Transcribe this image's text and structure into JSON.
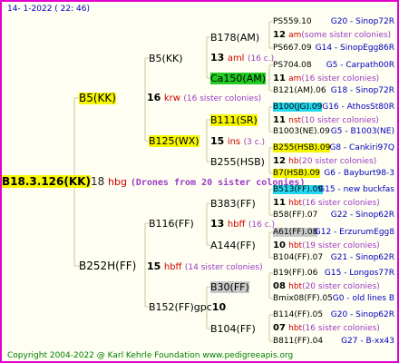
{
  "stamp": "14-  1-2022 (  22:  46)",
  "root": {
    "id": "B18.3.126(KK)",
    "num": "18",
    "sub": "hbg",
    "note": "(Drones from 20 sister colonies)"
  },
  "l1a": {
    "id": "B5(KK)",
    "num": "16",
    "sub": "krw",
    "note": "(16 sister colonies)"
  },
  "l1b": {
    "id": "B252H(FF)",
    "num": "15",
    "sub": "hbff",
    "note": "(14 sister colonies)"
  },
  "l2a": {
    "id": "B5(KK)",
    "num": "13",
    "sub": "aml",
    "note": "(16 c.)"
  },
  "l2b": {
    "id": "B125(WX)",
    "num": "15",
    "sub": "ins",
    "note": "(3 c.)"
  },
  "l2c": {
    "id": "B116(FF)",
    "num": "13",
    "sub": "hbff",
    "note": "(16 c.)"
  },
  "l2d": {
    "id": "B152(FF)gpc",
    "num": "10"
  },
  "l3": [
    {
      "id": "B178(AM)",
      "num": "12",
      "sub": "am",
      "note": "(some sister colonies)",
      "top": "PS559.10",
      "top_tag": "G20 - Sinop72R",
      "bot": "PS667.09",
      "bot_tag": "G14 - SinopEgg86R"
    },
    {
      "id": "Ca150(AM)",
      "num": "11",
      "sub": "am",
      "note": "(16 sister colonies)",
      "top": "PS704.08",
      "top_tag": "G5 - Carpath00R",
      "bot": "B121(AM).06",
      "bot_tag": "G18 - Sinop72R"
    },
    {
      "id": "B111(SR)",
      "num": "11",
      "sub": "nst",
      "note": "(10 sister colonies)",
      "top": "B100(JG).09",
      "top_tag": "G16 - AthosSt80R",
      "bot": "B1003(NE).09",
      "bot_tag": "G5 - B1003(NE)"
    },
    {
      "id": "B255(HSB)",
      "num": "12",
      "sub": "hb",
      "note": "(20 sister colonies)",
      "top": "B255(HSB).09",
      "top_tag": "G8 - Cankiri97Q",
      "bot": "B7(HSB).09",
      "bot_tag": "G6 - Bayburt98-3"
    },
    {
      "id": "B383(FF)",
      "num": "11",
      "sub": "hbt",
      "note": "(16 sister colonies)",
      "top": "B513(FF).09",
      "top_tag": "G15 - new buckfas",
      "bot": "B58(FF).07",
      "bot_tag": "G22 - Sinop62R"
    },
    {
      "id": "A144(FF)",
      "num": "10",
      "sub": "hbt",
      "note": "(19 sister colonies)",
      "top": "A61(FF).08",
      "top_tag": "G12 - ErzurumEgg8",
      "bot": "B104(FF).07",
      "bot_tag": "G21 - Sinop62R"
    },
    {
      "id": "B30(FF)",
      "num": "08",
      "sub": "hbt",
      "note": "(20 sister colonies)",
      "top": "B19(FF).06",
      "top_tag": "G15 - Longos77R",
      "bot": "Bmix08(FF).05",
      "bot_tag": "G0 - old lines B"
    },
    {
      "id": "B104(FF)",
      "num": "07",
      "sub": "hbt",
      "note": "(16 sister colonies)",
      "top": "B114(FF).05",
      "top_tag": "G20 - Sinop62R",
      "bot": "B811(FF).04",
      "bot_tag": "G27 - B-xx43"
    }
  ],
  "footer": "Copyright 2004-2022 @ Karl Kehrle Foundation    www.pedigreeapis.org",
  "colors": {
    "frame": "#e000d0",
    "line": "#c8c8a0",
    "highlight_yellow": "#f6f600",
    "highlight_green": "#22cc22",
    "highlight_cyan": "#22d8f0"
  }
}
